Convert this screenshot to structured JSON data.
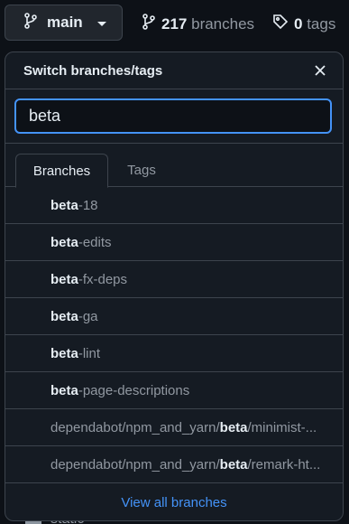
{
  "header": {
    "branch_button_label": "main",
    "branches_count": "217",
    "branches_label": "branches",
    "tags_count": "0",
    "tags_label": "tags"
  },
  "background_row": {
    "label": "static"
  },
  "popup": {
    "title": "Switch branches/tags",
    "search_value": "beta",
    "tabs": {
      "branches": "Branches",
      "tags": "Tags"
    },
    "items": [
      {
        "prefix": "",
        "match": "beta",
        "suffix": "-18"
      },
      {
        "prefix": "",
        "match": "beta",
        "suffix": "-edits"
      },
      {
        "prefix": "",
        "match": "beta",
        "suffix": "-fx-deps"
      },
      {
        "prefix": "",
        "match": "beta",
        "suffix": "-ga"
      },
      {
        "prefix": "",
        "match": "beta",
        "suffix": "-lint"
      },
      {
        "prefix": "",
        "match": "beta",
        "suffix": "-page-descriptions"
      },
      {
        "prefix": "dependabot/npm_and_yarn/",
        "match": "beta",
        "suffix": "/minimist-..."
      },
      {
        "prefix": "dependabot/npm_and_yarn/",
        "match": "beta",
        "suffix": "/remark-ht..."
      }
    ],
    "footer_link": "View all branches"
  },
  "icons": {
    "branch": "git-branch-icon",
    "tag": "tag-icon",
    "close": "close-icon",
    "caret": "caret-down-icon"
  },
  "colors": {
    "accent": "#4493f8",
    "background": "#0d1117",
    "popup_bg": "#151b23",
    "border": "#3d444d"
  }
}
